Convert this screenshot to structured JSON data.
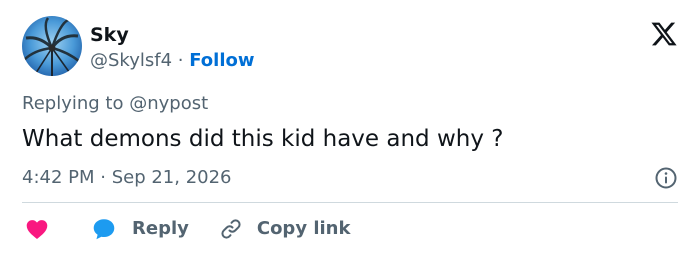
{
  "author": {
    "display_name": "Sky",
    "handle": "@Skylsf4",
    "separator": "·",
    "follow_label": "Follow"
  },
  "tweet": {
    "replying_prefix": "Replying to ",
    "replying_to": "@nypost",
    "text": "What demons did this kid have and why ?",
    "timestamp": "4:42 PM · Sep 21, 2026"
  },
  "actions": {
    "reply_label": "Reply",
    "copy_link_label": "Copy link"
  },
  "colors": {
    "accent": "#006fd6",
    "heart": "#f91880",
    "reply_bubble": "#1d9bf0",
    "muted_text": "#536471",
    "primary_text": "#0f1419",
    "divider": "#cfd9de"
  },
  "icons": {
    "logo": "x-logo-icon",
    "info": "info-icon",
    "like": "heart-icon",
    "reply": "speech-bubble-icon",
    "copy": "link-icon"
  }
}
